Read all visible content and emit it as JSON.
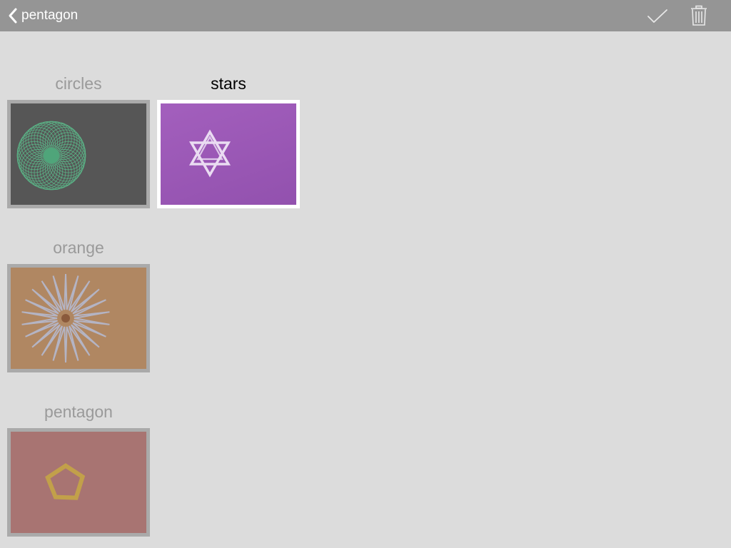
{
  "header": {
    "back_label": "pentagon",
    "icons": {
      "back": "chevron-left-icon",
      "confirm": "checkmark-icon",
      "delete": "trash-icon"
    }
  },
  "gallery": {
    "items": [
      {
        "title": "circles",
        "selected": false,
        "color": "#565656",
        "motif_color": "#5bb98a"
      },
      {
        "title": "stars",
        "selected": true,
        "color": "#9b59b6",
        "motif_color": "#e8d6f0"
      },
      {
        "title": "orange",
        "selected": false,
        "color": "#b08762",
        "motif_color": "#b4b4c4"
      },
      {
        "title": "pentagon",
        "selected": false,
        "color": "#a87472",
        "motif_color": "#c2a04a"
      }
    ]
  }
}
